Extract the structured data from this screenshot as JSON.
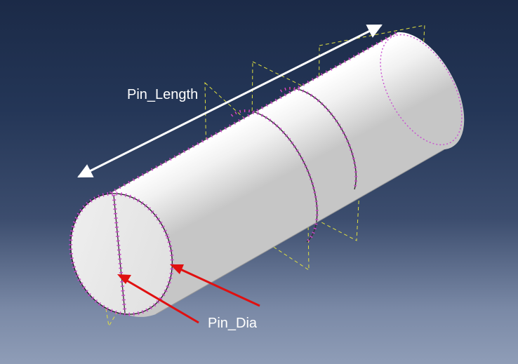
{
  "labels": {
    "pin_length": "Pin_Length",
    "pin_dia": "Pin_Dia"
  },
  "colors": {
    "background_top": "#1b2a47",
    "background_bottom": "#8f9db7",
    "part_surface": "#e6e6e6",
    "mesh_seed": "#cc44cc",
    "datum_plane": "#e0e040",
    "annotation_arrow": "#e01010",
    "dimension_arrow": "#ffffff"
  }
}
